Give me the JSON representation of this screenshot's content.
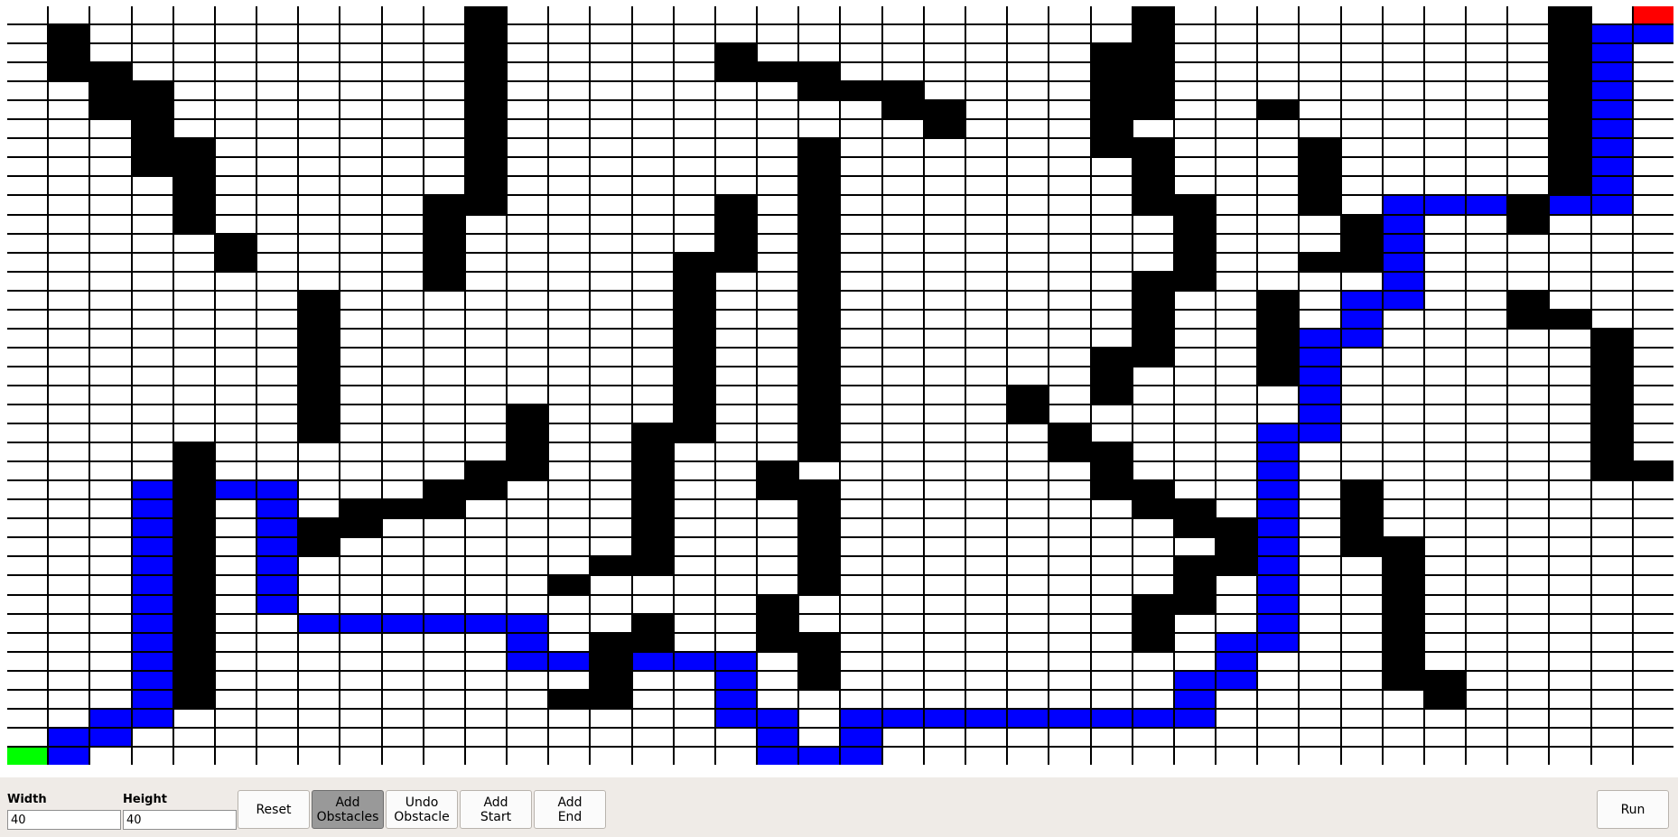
{
  "grid": {
    "columns": 40,
    "rows": 40,
    "start": [
      0,
      39
    ],
    "end": [
      39,
      0
    ],
    "obstacles": [
      [
        11,
        0
      ],
      [
        27,
        0
      ],
      [
        37,
        0
      ],
      [
        1,
        1
      ],
      [
        11,
        1
      ],
      [
        27,
        1
      ],
      [
        37,
        1
      ],
      [
        1,
        2
      ],
      [
        11,
        2
      ],
      [
        17,
        2
      ],
      [
        26,
        2
      ],
      [
        27,
        2
      ],
      [
        37,
        2
      ],
      [
        1,
        3
      ],
      [
        2,
        3
      ],
      [
        11,
        3
      ],
      [
        17,
        3
      ],
      [
        18,
        3
      ],
      [
        19,
        3
      ],
      [
        26,
        3
      ],
      [
        27,
        3
      ],
      [
        37,
        3
      ],
      [
        2,
        4
      ],
      [
        3,
        4
      ],
      [
        11,
        4
      ],
      [
        19,
        4
      ],
      [
        20,
        4
      ],
      [
        21,
        4
      ],
      [
        26,
        4
      ],
      [
        27,
        4
      ],
      [
        37,
        4
      ],
      [
        2,
        5
      ],
      [
        3,
        5
      ],
      [
        11,
        5
      ],
      [
        21,
        5
      ],
      [
        22,
        5
      ],
      [
        26,
        5
      ],
      [
        27,
        5
      ],
      [
        30,
        5
      ],
      [
        37,
        5
      ],
      [
        3,
        6
      ],
      [
        11,
        6
      ],
      [
        22,
        6
      ],
      [
        26,
        6
      ],
      [
        37,
        6
      ],
      [
        3,
        7
      ],
      [
        4,
        7
      ],
      [
        11,
        7
      ],
      [
        19,
        7
      ],
      [
        26,
        7
      ],
      [
        27,
        7
      ],
      [
        31,
        7
      ],
      [
        37,
        7
      ],
      [
        3,
        8
      ],
      [
        4,
        8
      ],
      [
        11,
        8
      ],
      [
        19,
        8
      ],
      [
        27,
        8
      ],
      [
        31,
        8
      ],
      [
        37,
        8
      ],
      [
        4,
        9
      ],
      [
        11,
        9
      ],
      [
        19,
        9
      ],
      [
        27,
        9
      ],
      [
        31,
        9
      ],
      [
        37,
        9
      ],
      [
        4,
        10
      ],
      [
        10,
        10
      ],
      [
        11,
        10
      ],
      [
        17,
        10
      ],
      [
        19,
        10
      ],
      [
        27,
        10
      ],
      [
        28,
        10
      ],
      [
        31,
        10
      ],
      [
        36,
        10
      ],
      [
        4,
        11
      ],
      [
        10,
        11
      ],
      [
        17,
        11
      ],
      [
        19,
        11
      ],
      [
        28,
        11
      ],
      [
        32,
        11
      ],
      [
        36,
        11
      ],
      [
        5,
        12
      ],
      [
        10,
        12
      ],
      [
        17,
        12
      ],
      [
        19,
        12
      ],
      [
        28,
        12
      ],
      [
        32,
        12
      ],
      [
        5,
        13
      ],
      [
        10,
        13
      ],
      [
        16,
        13
      ],
      [
        17,
        13
      ],
      [
        19,
        13
      ],
      [
        28,
        13
      ],
      [
        31,
        13
      ],
      [
        32,
        13
      ],
      [
        10,
        14
      ],
      [
        16,
        14
      ],
      [
        19,
        14
      ],
      [
        27,
        14
      ],
      [
        28,
        14
      ],
      [
        7,
        15
      ],
      [
        16,
        15
      ],
      [
        19,
        15
      ],
      [
        27,
        15
      ],
      [
        30,
        15
      ],
      [
        36,
        15
      ],
      [
        7,
        16
      ],
      [
        16,
        16
      ],
      [
        19,
        16
      ],
      [
        27,
        16
      ],
      [
        30,
        16
      ],
      [
        36,
        16
      ],
      [
        37,
        16
      ],
      [
        7,
        17
      ],
      [
        16,
        17
      ],
      [
        19,
        17
      ],
      [
        27,
        17
      ],
      [
        30,
        17
      ],
      [
        38,
        17
      ],
      [
        7,
        18
      ],
      [
        16,
        18
      ],
      [
        19,
        18
      ],
      [
        26,
        18
      ],
      [
        27,
        18
      ],
      [
        30,
        18
      ],
      [
        38,
        18
      ],
      [
        7,
        19
      ],
      [
        16,
        19
      ],
      [
        19,
        19
      ],
      [
        26,
        19
      ],
      [
        30,
        19
      ],
      [
        38,
        19
      ],
      [
        7,
        20
      ],
      [
        16,
        20
      ],
      [
        19,
        20
      ],
      [
        24,
        20
      ],
      [
        26,
        20
      ],
      [
        38,
        20
      ],
      [
        7,
        21
      ],
      [
        12,
        21
      ],
      [
        16,
        21
      ],
      [
        19,
        21
      ],
      [
        24,
        21
      ],
      [
        38,
        21
      ],
      [
        7,
        22
      ],
      [
        12,
        22
      ],
      [
        15,
        22
      ],
      [
        16,
        22
      ],
      [
        19,
        22
      ],
      [
        25,
        22
      ],
      [
        38,
        22
      ],
      [
        4,
        23
      ],
      [
        12,
        23
      ],
      [
        15,
        23
      ],
      [
        19,
        23
      ],
      [
        25,
        23
      ],
      [
        26,
        23
      ],
      [
        38,
        23
      ],
      [
        4,
        24
      ],
      [
        11,
        24
      ],
      [
        12,
        24
      ],
      [
        15,
        24
      ],
      [
        18,
        24
      ],
      [
        26,
        24
      ],
      [
        38,
        24
      ],
      [
        39,
        24
      ],
      [
        4,
        25
      ],
      [
        10,
        25
      ],
      [
        11,
        25
      ],
      [
        15,
        25
      ],
      [
        18,
        25
      ],
      [
        19,
        25
      ],
      [
        26,
        25
      ],
      [
        27,
        25
      ],
      [
        32,
        25
      ],
      [
        4,
        26
      ],
      [
        8,
        26
      ],
      [
        9,
        26
      ],
      [
        10,
        26
      ],
      [
        15,
        26
      ],
      [
        19,
        26
      ],
      [
        27,
        26
      ],
      [
        28,
        26
      ],
      [
        32,
        26
      ],
      [
        4,
        27
      ],
      [
        7,
        27
      ],
      [
        8,
        27
      ],
      [
        15,
        27
      ],
      [
        19,
        27
      ],
      [
        28,
        27
      ],
      [
        29,
        27
      ],
      [
        32,
        27
      ],
      [
        4,
        28
      ],
      [
        7,
        28
      ],
      [
        15,
        28
      ],
      [
        19,
        28
      ],
      [
        29,
        28
      ],
      [
        32,
        28
      ],
      [
        33,
        28
      ],
      [
        4,
        29
      ],
      [
        14,
        29
      ],
      [
        15,
        29
      ],
      [
        19,
        29
      ],
      [
        28,
        29
      ],
      [
        29,
        29
      ],
      [
        33,
        29
      ],
      [
        4,
        30
      ],
      [
        13,
        30
      ],
      [
        19,
        30
      ],
      [
        28,
        30
      ],
      [
        33,
        30
      ],
      [
        4,
        31
      ],
      [
        18,
        31
      ],
      [
        27,
        31
      ],
      [
        28,
        31
      ],
      [
        33,
        31
      ],
      [
        4,
        32
      ],
      [
        15,
        32
      ],
      [
        18,
        32
      ],
      [
        27,
        32
      ],
      [
        33,
        32
      ],
      [
        4,
        33
      ],
      [
        14,
        33
      ],
      [
        15,
        33
      ],
      [
        18,
        33
      ],
      [
        19,
        33
      ],
      [
        27,
        33
      ],
      [
        33,
        33
      ],
      [
        4,
        34
      ],
      [
        14,
        34
      ],
      [
        19,
        34
      ],
      [
        33,
        34
      ],
      [
        4,
        35
      ],
      [
        14,
        35
      ],
      [
        19,
        35
      ],
      [
        33,
        35
      ],
      [
        34,
        35
      ],
      [
        4,
        36
      ],
      [
        13,
        36
      ],
      [
        14,
        36
      ],
      [
        34,
        36
      ]
    ],
    "path": [
      [
        1,
        39
      ],
      [
        1,
        38
      ],
      [
        2,
        38
      ],
      [
        2,
        37
      ],
      [
        3,
        37
      ],
      [
        3,
        36
      ],
      [
        3,
        35
      ],
      [
        3,
        34
      ],
      [
        3,
        33
      ],
      [
        3,
        32
      ],
      [
        3,
        31
      ],
      [
        3,
        30
      ],
      [
        3,
        29
      ],
      [
        3,
        28
      ],
      [
        3,
        27
      ],
      [
        3,
        26
      ],
      [
        3,
        25
      ],
      [
        4,
        25
      ],
      [
        5,
        25
      ],
      [
        6,
        25
      ],
      [
        6,
        26
      ],
      [
        6,
        27
      ],
      [
        6,
        28
      ],
      [
        6,
        29
      ],
      [
        6,
        30
      ],
      [
        6,
        31
      ],
      [
        7,
        32
      ],
      [
        8,
        32
      ],
      [
        9,
        32
      ],
      [
        10,
        32
      ],
      [
        11,
        32
      ],
      [
        12,
        32
      ],
      [
        12,
        33
      ],
      [
        12,
        34
      ],
      [
        13,
        34
      ],
      [
        14,
        34
      ],
      [
        15,
        34
      ],
      [
        16,
        34
      ],
      [
        17,
        34
      ],
      [
        17,
        35
      ],
      [
        17,
        36
      ],
      [
        17,
        37
      ],
      [
        18,
        37
      ],
      [
        18,
        38
      ],
      [
        18,
        39
      ],
      [
        19,
        39
      ],
      [
        20,
        39
      ],
      [
        20,
        38
      ],
      [
        20,
        37
      ],
      [
        21,
        37
      ],
      [
        22,
        37
      ],
      [
        23,
        37
      ],
      [
        24,
        37
      ],
      [
        25,
        37
      ],
      [
        26,
        37
      ],
      [
        27,
        37
      ],
      [
        28,
        37
      ],
      [
        28,
        36
      ],
      [
        28,
        35
      ],
      [
        29,
        35
      ],
      [
        29,
        34
      ],
      [
        29,
        33
      ],
      [
        30,
        33
      ],
      [
        30,
        32
      ],
      [
        30,
        31
      ],
      [
        30,
        30
      ],
      [
        30,
        29
      ],
      [
        30,
        28
      ],
      [
        30,
        27
      ],
      [
        30,
        26
      ],
      [
        30,
        25
      ],
      [
        30,
        24
      ],
      [
        30,
        23
      ],
      [
        30,
        22
      ],
      [
        31,
        22
      ],
      [
        31,
        21
      ],
      [
        31,
        20
      ],
      [
        31,
        19
      ],
      [
        31,
        18
      ],
      [
        31,
        17
      ],
      [
        32,
        17
      ],
      [
        32,
        16
      ],
      [
        32,
        15
      ],
      [
        33,
        15
      ],
      [
        33,
        14
      ],
      [
        33,
        13
      ],
      [
        33,
        12
      ],
      [
        33,
        11
      ],
      [
        33,
        10
      ],
      [
        34,
        10
      ],
      [
        35,
        10
      ],
      [
        36,
        10
      ],
      [
        37,
        10
      ],
      [
        38,
        10
      ],
      [
        38,
        9
      ],
      [
        38,
        8
      ],
      [
        38,
        7
      ],
      [
        38,
        6
      ],
      [
        38,
        5
      ],
      [
        38,
        4
      ],
      [
        38,
        3
      ],
      [
        38,
        2
      ],
      [
        38,
        1
      ],
      [
        39,
        1
      ]
    ]
  },
  "controls": {
    "width_label": "Width",
    "width_value": "40",
    "height_label": "Height",
    "height_value": "40",
    "reset": "Reset",
    "add_obstacles": "Add\nObstacles",
    "undo_obstacle": "Undo\nObstacle",
    "add_start": "Add\nStart",
    "add_end": "Add\nEnd",
    "run": "Run",
    "active_tool": "add_obstacles"
  },
  "colors": {
    "start": "#00ff00",
    "end": "#ff0000",
    "path": "#0000ff",
    "obstacle": "#000000",
    "empty": "#ffffff",
    "active_button": "#999999"
  }
}
